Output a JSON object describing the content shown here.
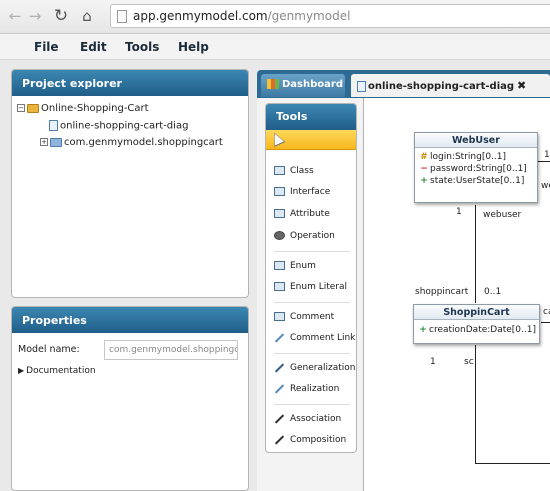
{
  "browser": {
    "url_host": "app.genmymodel.com",
    "url_path": "/genmymodel"
  },
  "menu": {
    "items": [
      "File",
      "Edit",
      "Tools",
      "Help"
    ]
  },
  "project_explorer": {
    "title": "Project explorer",
    "tree": [
      {
        "label": "Online-Shopping-Cart",
        "toggle": "−"
      },
      {
        "label": "online-shopping-cart-diag"
      },
      {
        "label": "com.genmymodel.shoppingcart",
        "toggle": "+"
      }
    ]
  },
  "properties": {
    "title": "Properties",
    "model_name_label": "Model name:",
    "model_name_value": "com.genmymodel.shoppingca",
    "documentation_label": "Documentation"
  },
  "tabs": {
    "dashboard": "Dashboard",
    "diagram": "online-shopping-cart-diag",
    "close": "✖"
  },
  "tools": {
    "title": "Tools",
    "items": [
      "Class",
      "Interface",
      "Attribute",
      "Operation",
      "Enum",
      "Enum Literal",
      "Comment",
      "Comment Link",
      "Generalization",
      "Realization",
      "Association",
      "Composition"
    ]
  },
  "diagram": {
    "webuser": {
      "name": "WebUser",
      "attrs": [
        {
          "vis": "#",
          "text": "login:String[0..1]"
        },
        {
          "vis": "−",
          "text": "password:String[0..1]"
        },
        {
          "vis": "+",
          "text": "state:UserState[0..1]"
        }
      ]
    },
    "shoppincart": {
      "name": "ShoppinCart",
      "attrs": [
        {
          "vis": "+",
          "text": "creationDate:Date[0..1]"
        }
      ]
    },
    "labels": {
      "wu_mult_bottom": "1",
      "wu_role": "webuser",
      "wu_mult_right": "1",
      "wu_right_role": "we",
      "sc_role_top": "shoppincart",
      "sc_mult_top": "0..1",
      "sc_right": "ca",
      "sc_mult_bottom": "1",
      "sc_role_bottom": "sc"
    }
  }
}
